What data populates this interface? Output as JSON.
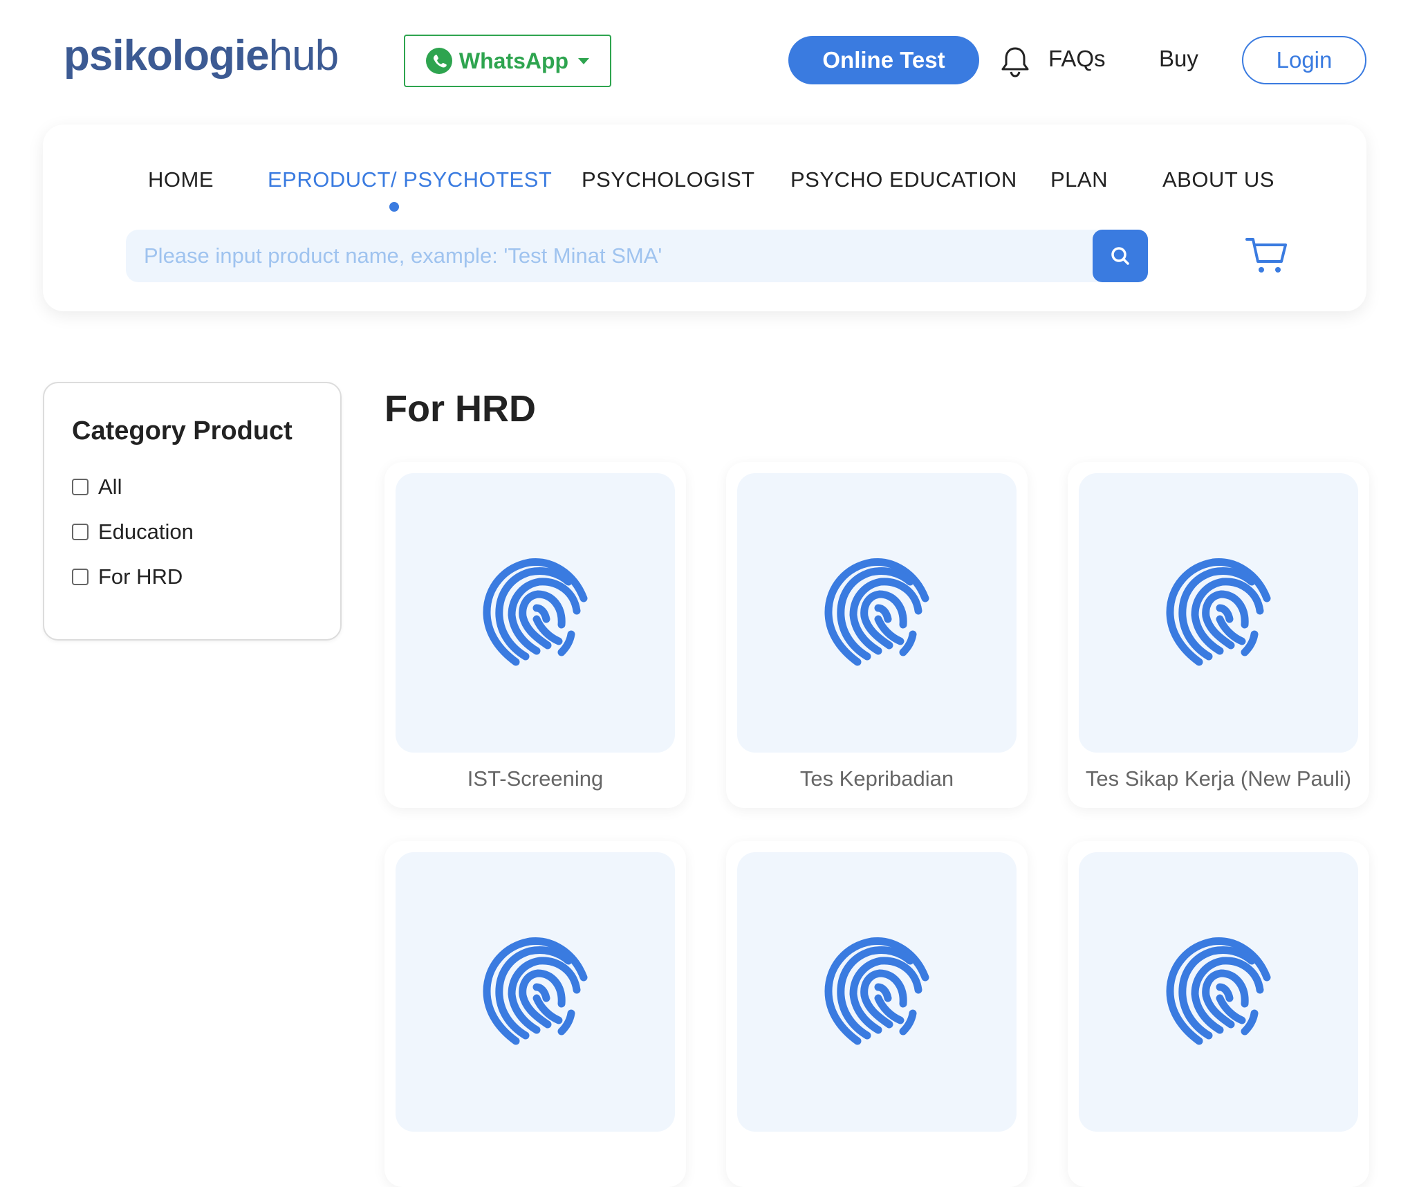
{
  "header": {
    "logo_bold": "psikologie",
    "logo_light": "hub",
    "whatsapp_label": "WhatsApp",
    "online_test_label": "Online Test",
    "faqs_label": "FAQs",
    "buy_label": "Buy",
    "login_label": "Login"
  },
  "nav": {
    "items": [
      {
        "label": "HOME"
      },
      {
        "label": "EPRODUCT/ PSYCHOTEST"
      },
      {
        "label": "PSYCHOLOGIST"
      },
      {
        "label": "PSYCHO EDUCATION"
      },
      {
        "label": "PLAN"
      },
      {
        "label": "ABOUT US"
      }
    ],
    "active_index": 1
  },
  "search": {
    "placeholder": "Please input product name, example: 'Test Minat SMA'",
    "value": ""
  },
  "sidebar": {
    "title": "Category Product",
    "categories": [
      {
        "label": "All",
        "checked": false
      },
      {
        "label": "Education",
        "checked": false
      },
      {
        "label": "For HRD",
        "checked": false
      }
    ]
  },
  "main": {
    "section_title": "For HRD",
    "products": [
      {
        "name": "IST-Screening",
        "icon": "fingerprint-icon"
      },
      {
        "name": "Tes Kepribadian",
        "icon": "fingerprint-icon"
      },
      {
        "name": "Tes Sikap Kerja (New Pauli)",
        "icon": "fingerprint-icon"
      },
      {
        "name": "",
        "icon": "fingerprint-icon"
      },
      {
        "name": "",
        "icon": "fingerprint-icon"
      },
      {
        "name": "",
        "icon": "fingerprint-icon"
      }
    ]
  },
  "colors": {
    "accent": "#3a7be0",
    "whatsapp": "#2ea44f",
    "logo": "#3c5a93",
    "thumb_bg": "#f0f6fd"
  }
}
